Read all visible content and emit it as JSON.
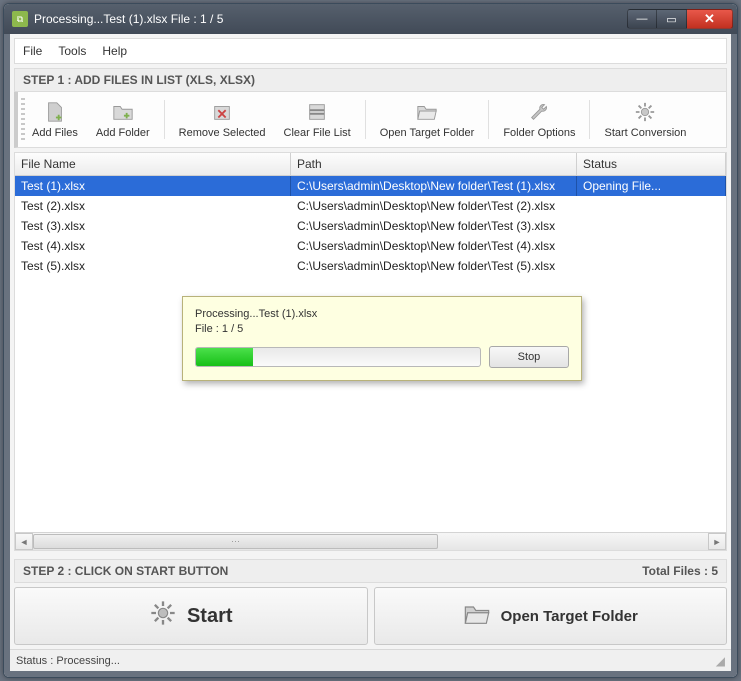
{
  "title": "Processing...Test (1).xlsx File : 1 / 5",
  "menubar": [
    "File",
    "Tools",
    "Help"
  ],
  "step1_header": "STEP 1 : ADD FILES IN LIST (XLS, XLSX)",
  "toolbar": {
    "add_files": "Add Files",
    "add_folder": "Add Folder",
    "remove_selected": "Remove Selected",
    "clear_list": "Clear File List",
    "open_target": "Open Target Folder",
    "folder_options": "Folder Options",
    "start_conversion": "Start Conversion"
  },
  "grid": {
    "columns": {
      "filename": "File Name",
      "path": "Path",
      "status": "Status"
    },
    "rows": [
      {
        "filename": "Test (1).xlsx",
        "path": "C:\\Users\\admin\\Desktop\\New folder\\Test (1).xlsx",
        "status": "Opening File...",
        "selected": true
      },
      {
        "filename": "Test (2).xlsx",
        "path": "C:\\Users\\admin\\Desktop\\New folder\\Test (2).xlsx",
        "status": "",
        "selected": false
      },
      {
        "filename": "Test (3).xlsx",
        "path": "C:\\Users\\admin\\Desktop\\New folder\\Test (3).xlsx",
        "status": "",
        "selected": false
      },
      {
        "filename": "Test (4).xlsx",
        "path": "C:\\Users\\admin\\Desktop\\New folder\\Test (4).xlsx",
        "status": "",
        "selected": false
      },
      {
        "filename": "Test (5).xlsx",
        "path": "C:\\Users\\admin\\Desktop\\New folder\\Test (5).xlsx",
        "status": "",
        "selected": false
      }
    ]
  },
  "step2_header": "STEP 2 : CLICK ON START BUTTON",
  "total_files_label": "Total Files : 5",
  "bottom": {
    "start": "Start",
    "open_target": "Open Target Folder"
  },
  "statusbar": "Status  :  Processing...",
  "dialog": {
    "line1": "Processing...Test (1).xlsx",
    "line2": "File : 1 / 5",
    "progress_percent": 20,
    "stop": "Stop"
  }
}
